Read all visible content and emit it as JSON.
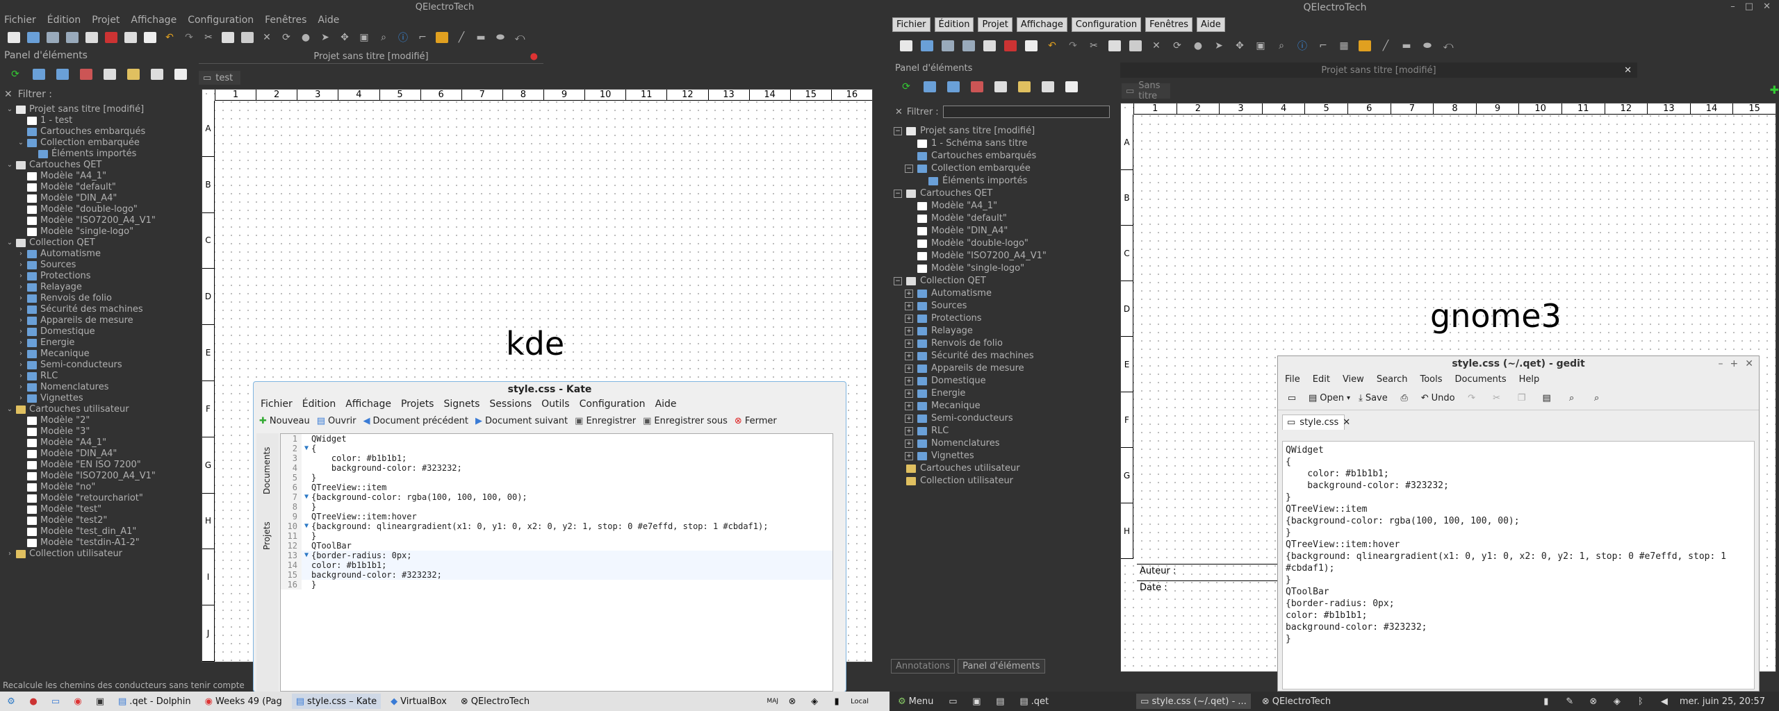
{
  "kde": {
    "title": "QElectroTech",
    "menu": [
      "Fichier",
      "Édition",
      "Projet",
      "Affichage",
      "Configuration",
      "Fenêtres",
      "Aide"
    ],
    "panel_title": "Panel d'éléments",
    "filter_label": "Filtrer :",
    "doc_title": "Projet sans titre [modifié]",
    "tab_label": "test",
    "canvas_label": "kde",
    "col_numbers": [
      "1",
      "2",
      "3",
      "4",
      "5",
      "6",
      "7",
      "8",
      "9",
      "10",
      "11",
      "12",
      "13",
      "14",
      "15",
      "16"
    ],
    "row_letters": [
      "A",
      "B",
      "C",
      "D",
      "E",
      "F",
      "G",
      "H",
      "I",
      "J"
    ],
    "status_text": "Recalcule les chemins des conducteurs sans tenir compte",
    "tree": [
      {
        "label": "Projet sans titre [modifié]",
        "level": 0,
        "exp": "⌄",
        "color": "#e8e8e8"
      },
      {
        "label": "1 - test",
        "level": 1,
        "exp": "",
        "color": "#ffffff"
      },
      {
        "label": "Cartouches embarqués",
        "level": 1,
        "exp": "",
        "color": "#6aa0d8"
      },
      {
        "label": "Collection embarquée",
        "level": 1,
        "exp": "⌄",
        "color": "#6aa0d8"
      },
      {
        "label": "Éléments importés",
        "level": 2,
        "exp": "",
        "color": "#6aa0d8"
      },
      {
        "label": "Cartouches QET",
        "level": 0,
        "exp": "⌄",
        "color": "#dddddd"
      },
      {
        "label": "Modèle \"A4_1\"",
        "level": 1,
        "exp": "",
        "color": "#ffffff"
      },
      {
        "label": "Modèle \"default\"",
        "level": 1,
        "exp": "",
        "color": "#ffffff"
      },
      {
        "label": "Modèle \"DIN_A4\"",
        "level": 1,
        "exp": "",
        "color": "#ffffff"
      },
      {
        "label": "Modèle \"double-logo\"",
        "level": 1,
        "exp": "",
        "color": "#ffffff"
      },
      {
        "label": "Modèle \"ISO7200_A4_V1\"",
        "level": 1,
        "exp": "",
        "color": "#ffffff"
      },
      {
        "label": "Modèle \"single-logo\"",
        "level": 1,
        "exp": "",
        "color": "#ffffff"
      },
      {
        "label": "Collection QET",
        "level": 0,
        "exp": "⌄",
        "color": "#dddddd"
      },
      {
        "label": "Automatisme",
        "level": 1,
        "exp": "›",
        "color": "#6aa0d8"
      },
      {
        "label": "Sources",
        "level": 1,
        "exp": "›",
        "color": "#6aa0d8"
      },
      {
        "label": "Protections",
        "level": 1,
        "exp": "›",
        "color": "#6aa0d8"
      },
      {
        "label": "Relayage",
        "level": 1,
        "exp": "›",
        "color": "#6aa0d8"
      },
      {
        "label": "Renvois de folio",
        "level": 1,
        "exp": "›",
        "color": "#6aa0d8"
      },
      {
        "label": "Sécurité des machines",
        "level": 1,
        "exp": "›",
        "color": "#6aa0d8"
      },
      {
        "label": "Appareils de mesure",
        "level": 1,
        "exp": "›",
        "color": "#6aa0d8"
      },
      {
        "label": "Domestique",
        "level": 1,
        "exp": "›",
        "color": "#6aa0d8"
      },
      {
        "label": "Energie",
        "level": 1,
        "exp": "›",
        "color": "#6aa0d8"
      },
      {
        "label": "Mecanique",
        "level": 1,
        "exp": "›",
        "color": "#6aa0d8"
      },
      {
        "label": "Semi-conducteurs",
        "level": 1,
        "exp": "›",
        "color": "#6aa0d8"
      },
      {
        "label": "RLC",
        "level": 1,
        "exp": "›",
        "color": "#6aa0d8"
      },
      {
        "label": "Nomenclatures",
        "level": 1,
        "exp": "›",
        "color": "#6aa0d8"
      },
      {
        "label": "Vignettes",
        "level": 1,
        "exp": "›",
        "color": "#6aa0d8"
      },
      {
        "label": "Cartouches utilisateur",
        "level": 0,
        "exp": "⌄",
        "color": "#e0c060"
      },
      {
        "label": "Modèle \"2\"",
        "level": 1,
        "exp": "",
        "color": "#ffffff"
      },
      {
        "label": "Modèle \"3\"",
        "level": 1,
        "exp": "",
        "color": "#ffffff"
      },
      {
        "label": "Modèle \"A4_1\"",
        "level": 1,
        "exp": "",
        "color": "#ffffff"
      },
      {
        "label": "Modèle \"DIN_A4\"",
        "level": 1,
        "exp": "",
        "color": "#ffffff"
      },
      {
        "label": "Modèle \"EN ISO 7200\"",
        "level": 1,
        "exp": "",
        "color": "#ffffff"
      },
      {
        "label": "Modèle \"ISO7200_A4_V1\"",
        "level": 1,
        "exp": "",
        "color": "#ffffff"
      },
      {
        "label": "Modèle \"no\"",
        "level": 1,
        "exp": "",
        "color": "#ffffff"
      },
      {
        "label": "Modèle \"retourchariot\"",
        "level": 1,
        "exp": "",
        "color": "#ffffff"
      },
      {
        "label": "Modèle \"test\"",
        "level": 1,
        "exp": "",
        "color": "#ffffff"
      },
      {
        "label": "Modèle \"test2\"",
        "level": 1,
        "exp": "",
        "color": "#ffffff"
      },
      {
        "label": "Modèle \"test_din_A1\"",
        "level": 1,
        "exp": "",
        "color": "#ffffff"
      },
      {
        "label": "Modèle \"testdin-A1-2\"",
        "level": 1,
        "exp": "",
        "color": "#ffffff"
      },
      {
        "label": "Collection utilisateur",
        "level": 0,
        "exp": "›",
        "color": "#e0c060"
      }
    ],
    "kate": {
      "title": "style.css - Kate",
      "menu": [
        "Fichier",
        "Édition",
        "Affichage",
        "Projets",
        "Signets",
        "Sessions",
        "Outils",
        "Configuration",
        "Aide"
      ],
      "toolbar": [
        "Nouveau",
        "Ouvrir",
        "Document précédent",
        "Document suivant",
        "Enregistrer",
        "Enregistrer sous",
        "Fermer"
      ],
      "side_tabs": [
        "Documents",
        "Projets"
      ],
      "lines": [
        "QWidget",
        "{",
        "    color: #b1b1b1;",
        "    background-color: #323232;",
        "}",
        "QTreeView::item",
        "{background-color: rgba(100, 100, 100, 00);",
        "}",
        "QTreeView::item:hover",
        "{background: qlineargradient(x1: 0, y1: 0, x2: 0, y2: 1, stop: 0 #e7effd, stop: 1 #cbdaf1);",
        "}",
        "QToolBar",
        "{border-radius: 0px;",
        "color: #b1b1b1;",
        "background-color: #323232;",
        "}"
      ]
    },
    "taskbar": [
      ".qet - Dolphin",
      "Weeks 49 (Pag",
      "style.css – Kate",
      "VirtualBox",
      "QElectroTech"
    ],
    "taskbar_tray": [
      "MAJ",
      "Local"
    ]
  },
  "gnome": {
    "title": "QElectroTech",
    "menu": [
      "Fichier",
      "Édition",
      "Projet",
      "Affichage",
      "Configuration",
      "Fenêtres",
      "Aide"
    ],
    "panel_title": "Panel d'éléments",
    "filter_label": "Filtrer :",
    "doc_title": "Projet sans titre [modifié]",
    "tab_label": "Sans titre",
    "canvas_label": "gnome3",
    "col_numbers": [
      "1",
      "2",
      "3",
      "4",
      "5",
      "6",
      "7",
      "8",
      "9",
      "10",
      "11",
      "12",
      "13",
      "14",
      "15"
    ],
    "row_letters": [
      "A",
      "B",
      "C",
      "D",
      "E",
      "F",
      "G",
      "H"
    ],
    "auteur_label": "Auteur :",
    "date_label": "Date :",
    "bottom_tabs": [
      "Annotations",
      "Panel d'éléments"
    ],
    "tree": [
      {
        "label": "Projet sans titre [modifié]",
        "level": 0,
        "exp": "−",
        "color": "#e8e8e8"
      },
      {
        "label": "1 - Schéma sans titre",
        "level": 1,
        "exp": "",
        "color": "#ffffff"
      },
      {
        "label": "Cartouches embarqués",
        "level": 1,
        "exp": "",
        "color": "#6aa0d8"
      },
      {
        "label": "Collection embarquée",
        "level": 1,
        "exp": "−",
        "color": "#6aa0d8"
      },
      {
        "label": "Éléments importés",
        "level": 2,
        "exp": "",
        "color": "#6aa0d8"
      },
      {
        "label": "Cartouches QET",
        "level": 0,
        "exp": "−",
        "color": "#dddddd"
      },
      {
        "label": "Modèle \"A4_1\"",
        "level": 1,
        "exp": "",
        "color": "#ffffff"
      },
      {
        "label": "Modèle \"default\"",
        "level": 1,
        "exp": "",
        "color": "#ffffff"
      },
      {
        "label": "Modèle \"DIN_A4\"",
        "level": 1,
        "exp": "",
        "color": "#ffffff"
      },
      {
        "label": "Modèle \"double-logo\"",
        "level": 1,
        "exp": "",
        "color": "#ffffff"
      },
      {
        "label": "Modèle \"ISO7200_A4_V1\"",
        "level": 1,
        "exp": "",
        "color": "#ffffff"
      },
      {
        "label": "Modèle \"single-logo\"",
        "level": 1,
        "exp": "",
        "color": "#ffffff"
      },
      {
        "label": "Collection QET",
        "level": 0,
        "exp": "−",
        "color": "#dddddd"
      },
      {
        "label": "Automatisme",
        "level": 1,
        "exp": "+",
        "color": "#6aa0d8"
      },
      {
        "label": "Sources",
        "level": 1,
        "exp": "+",
        "color": "#6aa0d8"
      },
      {
        "label": "Protections",
        "level": 1,
        "exp": "+",
        "color": "#6aa0d8"
      },
      {
        "label": "Relayage",
        "level": 1,
        "exp": "+",
        "color": "#6aa0d8"
      },
      {
        "label": "Renvois de folio",
        "level": 1,
        "exp": "+",
        "color": "#6aa0d8"
      },
      {
        "label": "Sécurité des machines",
        "level": 1,
        "exp": "+",
        "color": "#6aa0d8"
      },
      {
        "label": "Appareils de mesure",
        "level": 1,
        "exp": "+",
        "color": "#6aa0d8"
      },
      {
        "label": "Domestique",
        "level": 1,
        "exp": "+",
        "color": "#6aa0d8"
      },
      {
        "label": "Energie",
        "level": 1,
        "exp": "+",
        "color": "#6aa0d8"
      },
      {
        "label": "Mecanique",
        "level": 1,
        "exp": "+",
        "color": "#6aa0d8"
      },
      {
        "label": "Semi-conducteurs",
        "level": 1,
        "exp": "+",
        "color": "#6aa0d8"
      },
      {
        "label": "RLC",
        "level": 1,
        "exp": "+",
        "color": "#6aa0d8"
      },
      {
        "label": "Nomenclatures",
        "level": 1,
        "exp": "+",
        "color": "#6aa0d8"
      },
      {
        "label": "Vignettes",
        "level": 1,
        "exp": "+",
        "color": "#6aa0d8"
      },
      {
        "label": "Cartouches utilisateur",
        "level": 0,
        "exp": "",
        "color": "#e0c060"
      },
      {
        "label": "Collection utilisateur",
        "level": 0,
        "exp": "",
        "color": "#e0c060"
      }
    ],
    "gedit": {
      "title": "style.css (~/.qet) - gedit",
      "menu": [
        "File",
        "Edit",
        "View",
        "Search",
        "Tools",
        "Documents",
        "Help"
      ],
      "toolbar": [
        "Open",
        "Save",
        "Undo"
      ],
      "tab": "style.css"
    },
    "taskbar": [
      {
        "label": "Menu"
      },
      {
        "label": ".qet"
      },
      {
        "label": "style.css (~/.qet) - ..."
      },
      {
        "label": "QElectroTech"
      }
    ],
    "clock": "mer. juin 25, 20:57"
  },
  "colors": {
    "bg": "#323232",
    "fg": "#b1b1b1",
    "accent": "#2b78c5",
    "kde_frame": "#7fb5e0"
  }
}
